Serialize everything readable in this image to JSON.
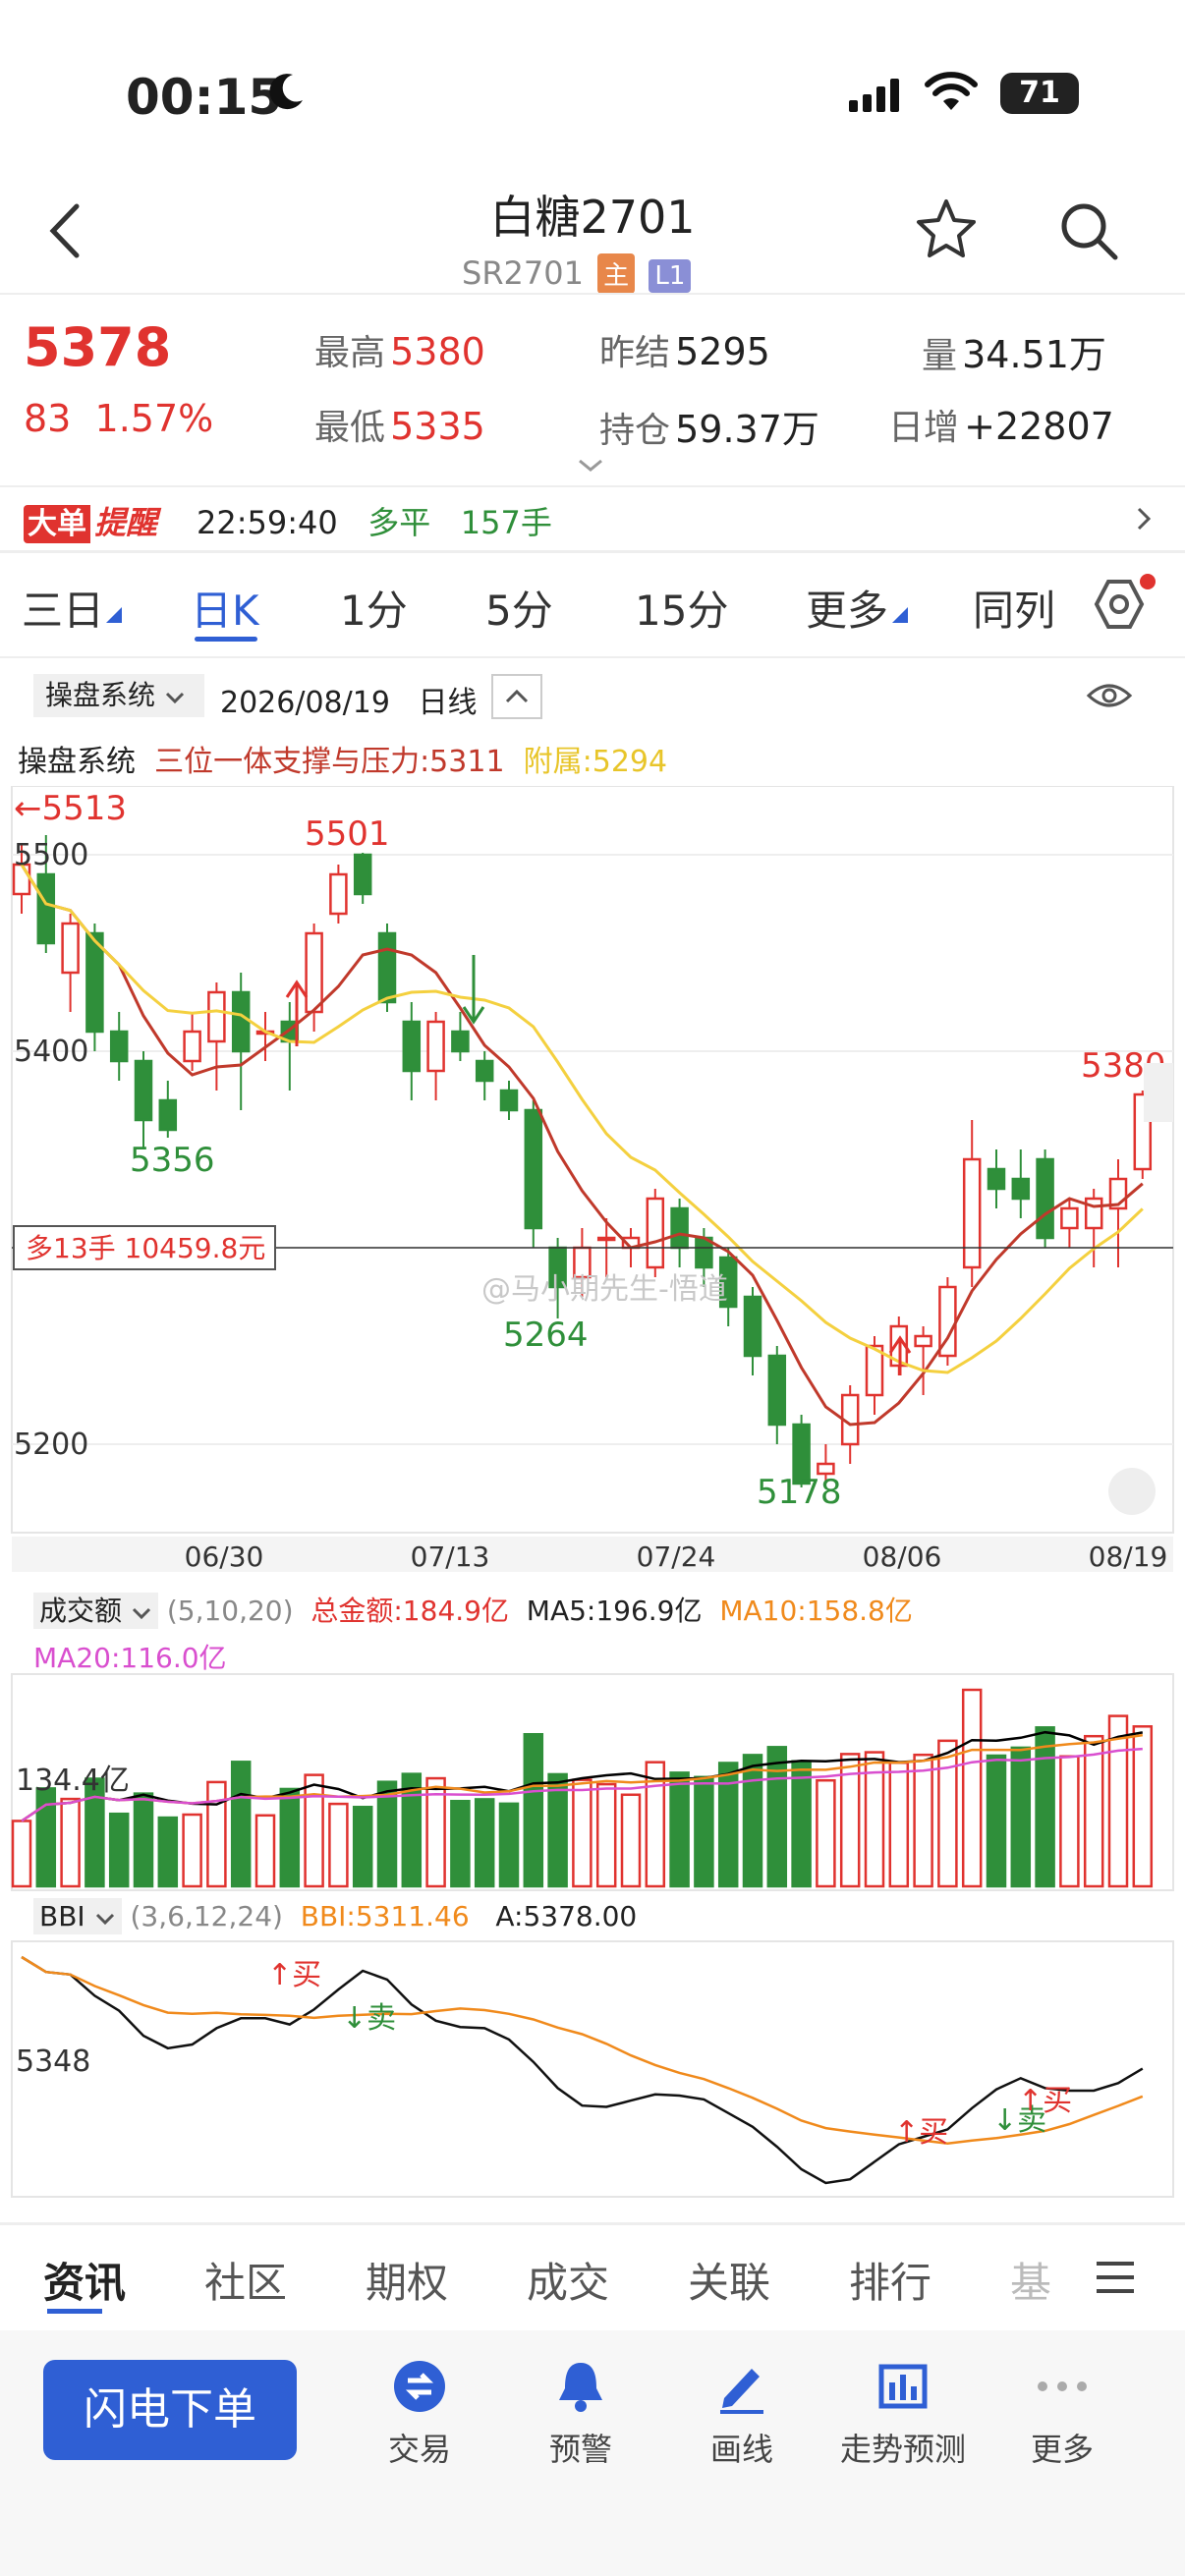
{
  "status_bar": {
    "time": "00:15",
    "battery": "71"
  },
  "header": {
    "title": "白糖2701",
    "code": "SR2701",
    "tag_main": "主",
    "tag_l1": "L1"
  },
  "quote": {
    "price": "5378",
    "change": "83",
    "change_pct": "1.57%",
    "high_label": "最高",
    "high": "5380",
    "low_label": "最低",
    "low": "5335",
    "prev_settle_label": "昨结",
    "prev_settle": "5295",
    "position_label": "持仓",
    "position": "59.37万",
    "volume_label": "量",
    "volume": "34.51万",
    "daily_inc_label": "日增",
    "daily_inc": "+22807"
  },
  "alert": {
    "badge_a": "大单",
    "badge_b": "提醒",
    "time": "22:59:40",
    "type": "多平",
    "qty": "157手"
  },
  "period_tabs": [
    "三日",
    "日K",
    "1分",
    "5分",
    "15分",
    "更多",
    "同列"
  ],
  "chart_header": {
    "system": "操盘系统",
    "date": "2026/08/19",
    "period": "日线",
    "ind_name": "操盘系统",
    "ind_main": "三位一体支撑与压力:5311",
    "ind_sub": "附属:5294"
  },
  "colors": {
    "up": "#e0332f",
    "down": "#2f8f3a",
    "accent": "#2f5fd4",
    "ma5": "#000000",
    "ma10": "#f08a1c",
    "ma20": "#d94fcf",
    "support": "#c0392b",
    "aux": "#f4d03f"
  },
  "chart_data": [
    {
      "type": "candlestick",
      "y_ticks": [
        "5500",
        "5400",
        "5300",
        "5200"
      ],
      "ylim": [
        5160,
        5530
      ],
      "x_ticks": [
        "06/30",
        "07/13",
        "07/24",
        "08/06",
        "08/19"
      ],
      "annotations": {
        "left_high": "5513",
        "high": "5501",
        "low1": "5356",
        "low2": "5264",
        "low3": "5178",
        "last": "5380"
      },
      "position_label": "多13手 10459.8元",
      "watermark": "@马小期先生-悟道",
      "candles": [
        [
          5480,
          5495,
          5470,
          5505
        ],
        [
          5490,
          5455,
          5450,
          5510
        ],
        [
          5440,
          5465,
          5420,
          5470
        ],
        [
          5460,
          5410,
          5400,
          5465
        ],
        [
          5410,
          5395,
          5385,
          5420
        ],
        [
          5395,
          5365,
          5350,
          5400
        ],
        [
          5375,
          5360,
          5356,
          5385
        ],
        [
          5395,
          5410,
          5390,
          5420
        ],
        [
          5405,
          5430,
          5380,
          5435
        ],
        [
          5430,
          5400,
          5370,
          5440
        ],
        [
          5410,
          5410,
          5395,
          5420
        ],
        [
          5415,
          5405,
          5380,
          5425
        ],
        [
          5420,
          5460,
          5410,
          5465
        ],
        [
          5470,
          5490,
          5465,
          5495
        ],
        [
          5500,
          5480,
          5475,
          5501
        ],
        [
          5460,
          5425,
          5420,
          5465
        ],
        [
          5415,
          5390,
          5375,
          5425
        ],
        [
          5390,
          5415,
          5375,
          5420
        ],
        [
          5410,
          5400,
          5395,
          5420
        ],
        [
          5395,
          5385,
          5375,
          5400
        ],
        [
          5380,
          5370,
          5365,
          5385
        ],
        [
          5370,
          5310,
          5300,
          5375
        ],
        [
          5300,
          5280,
          5264,
          5305
        ],
        [
          5285,
          5300,
          5275,
          5310
        ],
        [
          5305,
          5305,
          5285,
          5315
        ],
        [
          5300,
          5305,
          5290,
          5310
        ],
        [
          5290,
          5325,
          5285,
          5330
        ],
        [
          5320,
          5300,
          5290,
          5325
        ],
        [
          5305,
          5290,
          5280,
          5310
        ],
        [
          5295,
          5270,
          5260,
          5300
        ],
        [
          5275,
          5245,
          5235,
          5280
        ],
        [
          5245,
          5210,
          5200,
          5250
        ],
        [
          5210,
          5180,
          5178,
          5215
        ],
        [
          5185,
          5190,
          5180,
          5200
        ],
        [
          5200,
          5225,
          5190,
          5230
        ],
        [
          5225,
          5250,
          5215,
          5255
        ],
        [
          5240,
          5260,
          5235,
          5265
        ],
        [
          5250,
          5255,
          5225,
          5260
        ],
        [
          5245,
          5280,
          5240,
          5285
        ],
        [
          5290,
          5345,
          5280,
          5365
        ],
        [
          5340,
          5330,
          5320,
          5350
        ],
        [
          5335,
          5325,
          5315,
          5350
        ],
        [
          5345,
          5305,
          5300,
          5350
        ],
        [
          5310,
          5320,
          5300,
          5325
        ],
        [
          5310,
          5325,
          5290,
          5330
        ],
        [
          5320,
          5335,
          5290,
          5345
        ],
        [
          5340,
          5378,
          5335,
          5380
        ]
      ]
    },
    {
      "type": "bar",
      "name": "成交额",
      "params": "(5,10,20)",
      "total_label": "总金额:184.9亿",
      "ma5_label": "MA5:196.9亿",
      "ma10_label": "MA10:158.8亿",
      "ma20_label": "MA20:116.0亿",
      "y_tick": "134.4亿"
    },
    {
      "type": "line",
      "name": "BBI",
      "params": "(3,6,12,24)",
      "bbi_label": "BBI:5311.46",
      "a_label": "A:5378.00",
      "y_tick": "5348",
      "signals": [
        "↑买",
        "↓卖",
        "↑买",
        "↓卖",
        "↑买"
      ]
    }
  ],
  "bottom_tabs": [
    "资讯",
    "社区",
    "期权",
    "成交",
    "关联",
    "排行",
    "基"
  ],
  "bottom_bar": {
    "order": "闪电下单",
    "items": [
      "交易",
      "预警",
      "画线",
      "走势预测",
      "更多"
    ]
  }
}
